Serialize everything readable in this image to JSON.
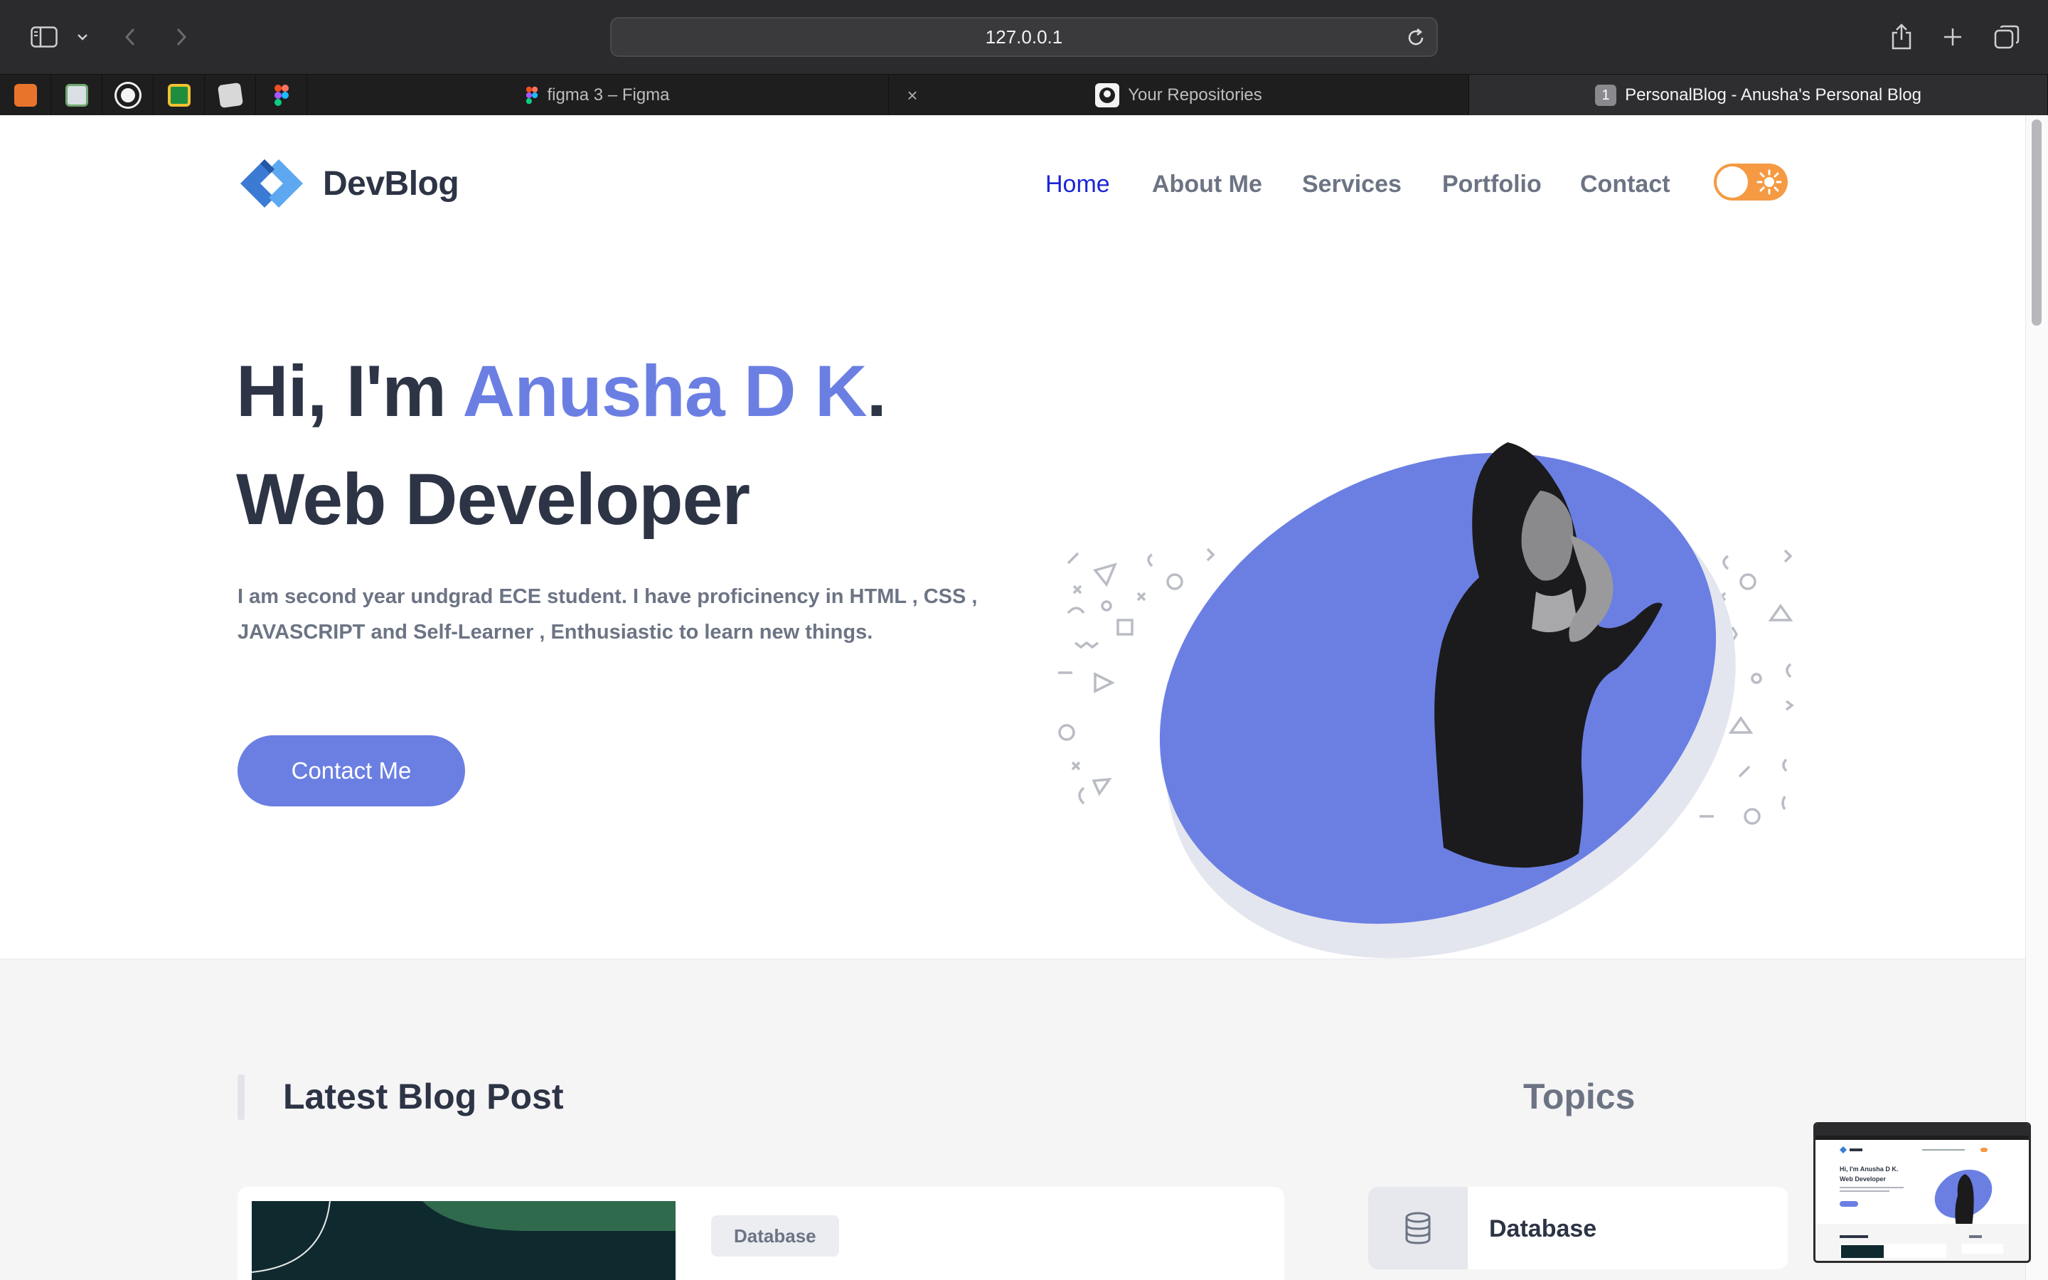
{
  "browser": {
    "url": "127.0.0.1",
    "tabs": [
      {
        "label": "figma 3 – Figma",
        "active": false
      },
      {
        "label": "Your Repositories",
        "active": false
      },
      {
        "label": "PersonalBlog - Anusha's Personal Blog",
        "active": true,
        "badge": "1"
      }
    ],
    "pinned_favicons": [
      "app-icon",
      "leetcode-icon",
      "github-icon",
      "classroom-icon",
      "notes-icon",
      "figma-icon"
    ]
  },
  "site": {
    "logo_text": "DevBlog",
    "nav": [
      "Home",
      "About Me",
      "Services",
      "Portfolio",
      "Contact"
    ],
    "active_nav": "Home",
    "theme_toggle": "light"
  },
  "hero": {
    "greeting_prefix": "Hi, I'm",
    "name": "Anusha D K",
    "greeting_suffix": ".",
    "role": "Web Developer",
    "description": "I am second year undgrad ECE student. I have proficinency in HTML , CSS , JAVASCRIPT and Self-Learner , Enthusiastic to learn new things.",
    "cta": "Contact Me"
  },
  "blog": {
    "heading": "Latest Blog Post",
    "post_tag": "Database"
  },
  "topics": {
    "heading": "Topics",
    "items": [
      "Database"
    ]
  },
  "preview": {
    "greeting": "Hi, I'm Anusha D K.",
    "role": "Web Developer"
  },
  "colors": {
    "accent": "#6b7fe3",
    "heading": "#2d3445",
    "muted": "#6c7484",
    "toggle": "#f59a43",
    "active_link": "#1b25d6"
  }
}
